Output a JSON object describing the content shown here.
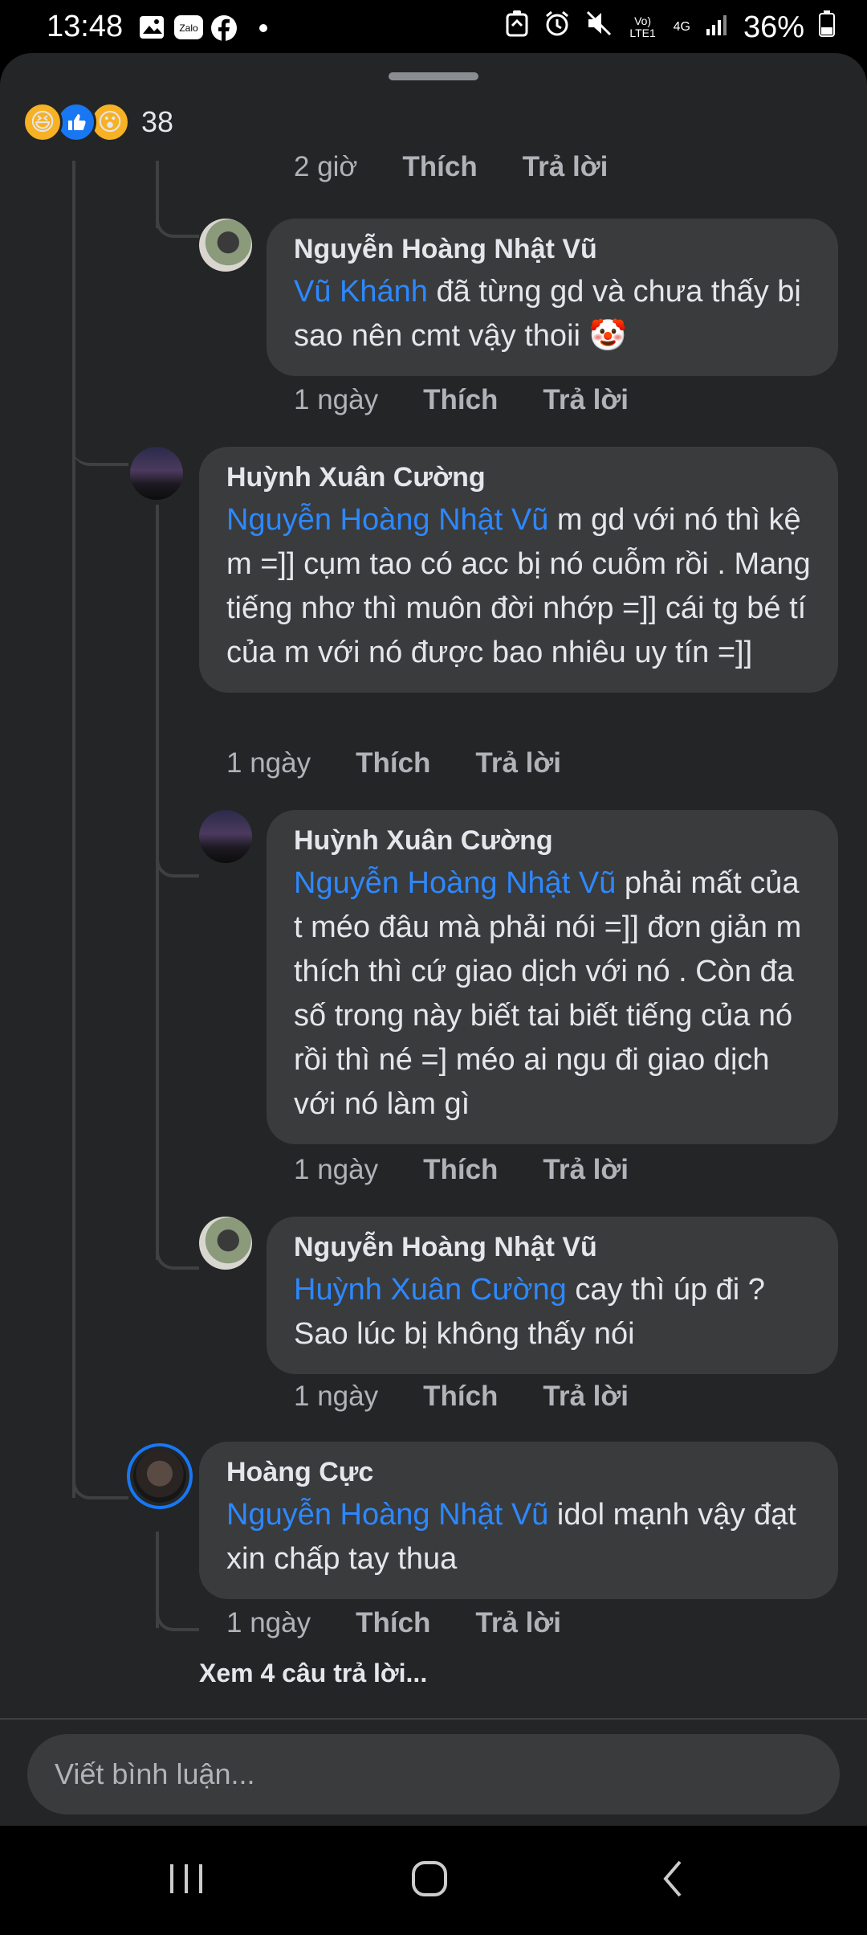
{
  "status_bar": {
    "time": "13:48",
    "battery": "36%",
    "network_lte": "Vo) LTE1",
    "network_4g": "4G",
    "icons": [
      "gallery-icon",
      "zalo-icon",
      "facebook-icon",
      "dot-icon",
      "recycle-icon",
      "alarm-icon",
      "mute-icon",
      "signal-icon",
      "battery-icon"
    ],
    "zalo_text": "Zalo"
  },
  "reactions": {
    "types": [
      "haha",
      "like",
      "wow"
    ],
    "count": "38"
  },
  "comments": [
    {
      "time": "2 giờ",
      "like_label": "Thích",
      "reply_label": "Trả lời"
    },
    {
      "author": "Nguyễn Hoàng Nhật Vũ",
      "mention": "Vũ Khánh",
      "text": " đã từng gd và chưa thấy bị sao nên cmt vậy thoii 🤡",
      "time": "1 ngày",
      "like_label": "Thích",
      "reply_label": "Trả lời"
    },
    {
      "author": "Huỳnh Xuân Cường",
      "mention": "Nguyễn Hoàng Nhật Vũ",
      "text": " m gd với nó thì kệ m =]] cụm tao có acc bị nó cuỗm rồi . Mang tiếng nhơ thì muôn đời nhớp =]] cái tg bé tí của m với nó được bao nhiêu uy tín =]]",
      "time": "1 ngày",
      "like_label": "Thích",
      "reply_label": "Trả lời"
    },
    {
      "author": "Huỳnh Xuân Cường",
      "mention": "Nguyễn Hoàng Nhật Vũ",
      "text": " phải mất của t méo đâu mà phải nói =]] đơn giản m thích thì cứ giao dịch với nó . Còn đa số trong này biết tai biết tiếng của nó rồi thì né =] méo ai ngu đi giao dịch với nó làm gì",
      "time": "1 ngày",
      "like_label": "Thích",
      "reply_label": "Trả lời"
    },
    {
      "author": "Nguyễn Hoàng Nhật Vũ",
      "mention": "Huỳnh Xuân Cường",
      "text": " cay thì úp đi ? Sao lúc bị không thấy nói",
      "time": "1 ngày",
      "like_label": "Thích",
      "reply_label": "Trả lời"
    },
    {
      "author": "Hoàng Cực",
      "mention": "Nguyễn Hoàng Nhật Vũ",
      "text": " idol mạnh vậy đạt xin chấp tay thua",
      "time": "1 ngày",
      "like_label": "Thích",
      "reply_label": "Trả lời"
    }
  ],
  "more_replies": "Xem 4 câu trả lời...",
  "composer": {
    "placeholder": "Viết bình luận..."
  },
  "nav_bar": {
    "buttons": [
      "recents-icon",
      "home-icon",
      "back-icon"
    ]
  },
  "colors": {
    "background": "#242526",
    "bubble": "#3a3b3c",
    "mention": "#2d88ff",
    "muted_text": "#b0b3b8",
    "primary_text": "#e4e6eb"
  }
}
